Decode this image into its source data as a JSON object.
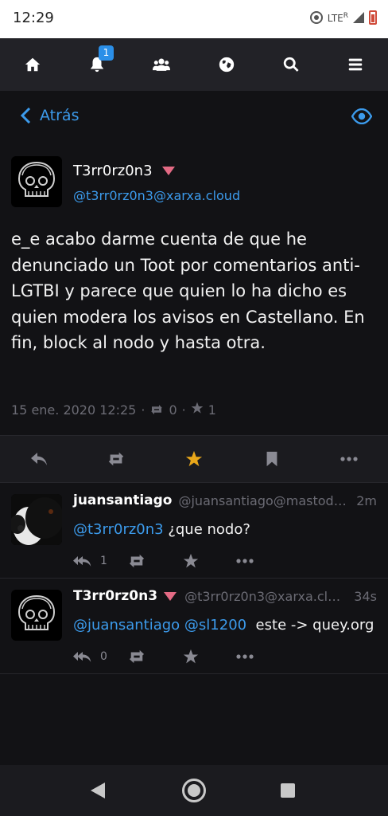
{
  "statusbar": {
    "time": "12:29",
    "network": "LTE",
    "network_sup": "R"
  },
  "nav": {
    "notifications_badge": "1"
  },
  "backbar": {
    "back_label": "Atrás"
  },
  "status": {
    "display_name": "T3rr0rz0n3",
    "acct": "@t3rr0rz0n3@xarxa.cloud",
    "content": "e_e acabo darme cuenta de que he denunciado un Toot por comentarios anti-LGTBI y parece que quien lo ha dicho es quien modera los avisos en Castellano. En fin, block al nodo y hasta otra.",
    "date": "15 ene. 2020 12:25",
    "separator": "·",
    "reblogs": "0",
    "favourites": "1"
  },
  "replies": [
    {
      "display_name": "juansantiago",
      "acct": "@juansantiago@mastod…",
      "time": "2m",
      "mention": "@t3rr0rz0n3",
      "text": " ¿que nodo?",
      "reply_count": "1"
    },
    {
      "display_name": "T3rr0rz0n3",
      "acct": "@t3rr0rz0n3@xarxa.cl…",
      "time": "34s",
      "mention": "@juansantiago @sl1200",
      "text": "  este -> quey.org",
      "reply_count": "0"
    }
  ],
  "colors": {
    "accent": "#3c9bec",
    "favourite": "#e9a71a",
    "lock_triangle": "#e36a84",
    "background": "#121215"
  }
}
